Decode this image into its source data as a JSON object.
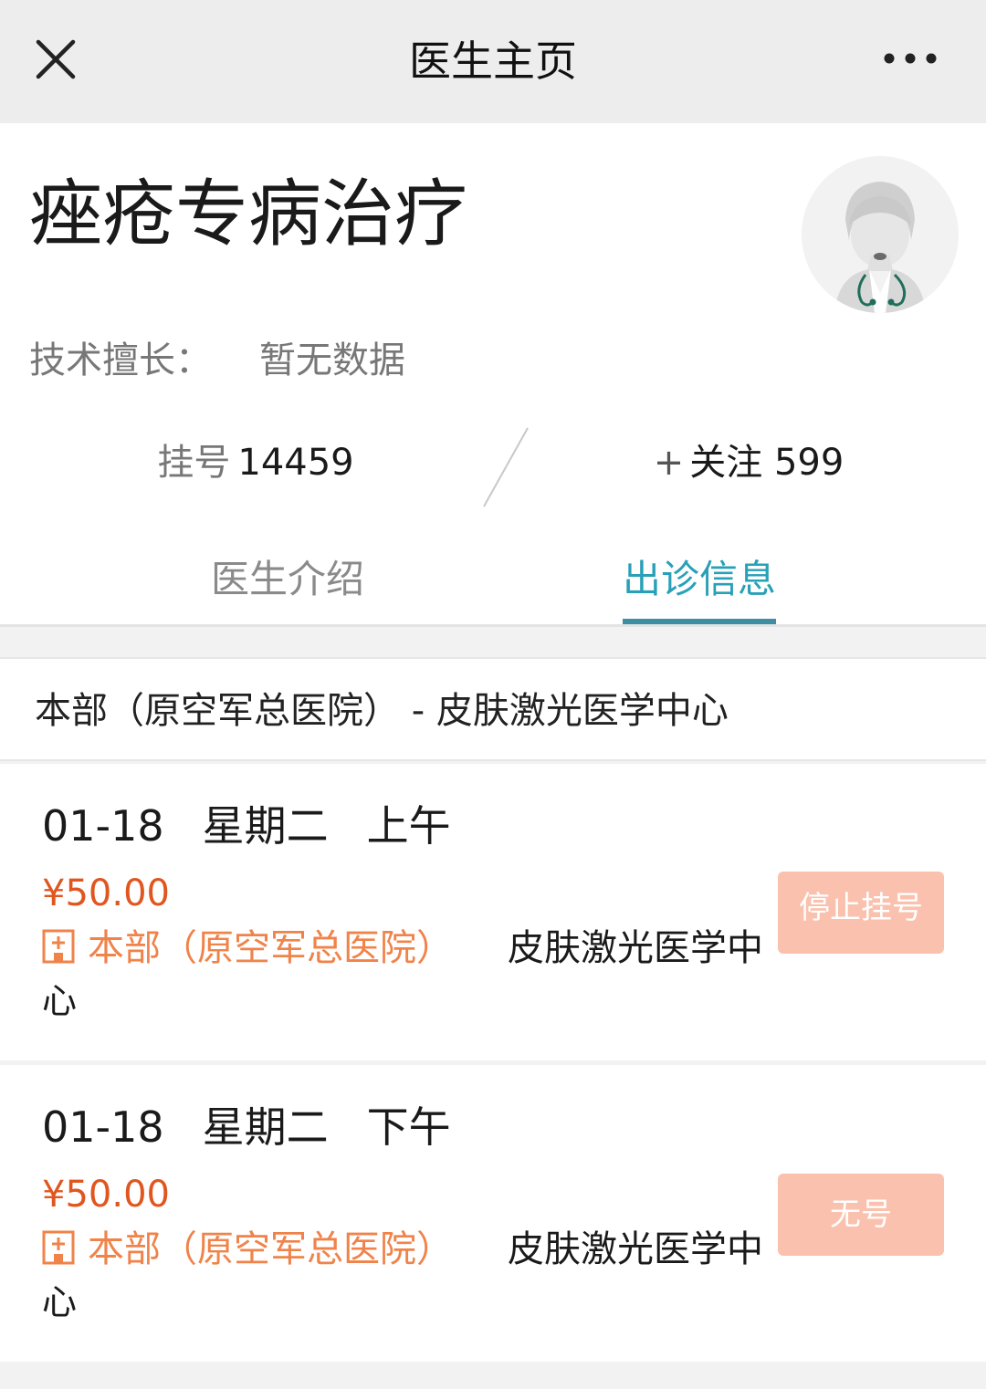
{
  "header": {
    "title": "医生主页",
    "close_icon": "close-icon",
    "more_icon": "more-icon"
  },
  "doctor": {
    "name": "痤疮专病治疗",
    "skill_label": "技术擅长：",
    "skill_value": "暂无数据",
    "reg_label": "挂号",
    "reg_count": "14459",
    "follow_plus": "+",
    "follow_label": "关注",
    "follow_count": "599"
  },
  "tabs": [
    {
      "label": "医生介绍",
      "active": false
    },
    {
      "label": "出诊信息",
      "active": true
    }
  ],
  "department": "本部（原空军总医院） - 皮肤激光医学中心",
  "slots": [
    {
      "date": "01-18",
      "weekday": "星期二",
      "period": "上午",
      "price": "¥50.00",
      "hospital": "本部（原空军总医院）",
      "dept_line1": "皮肤激光医学中",
      "dept_line2": "心",
      "button": "停止挂号"
    },
    {
      "date": "01-18",
      "weekday": "星期二",
      "period": "下午",
      "price": "¥50.00",
      "hospital": "本部（原空军总医院）",
      "dept_line1": "皮肤激光医学中",
      "dept_line2": "心",
      "button": "无号"
    }
  ],
  "colors": {
    "accent": "#27a0b8",
    "price": "#e0561f",
    "hospital": "#f0834a",
    "button_bg": "#fac1ae"
  }
}
